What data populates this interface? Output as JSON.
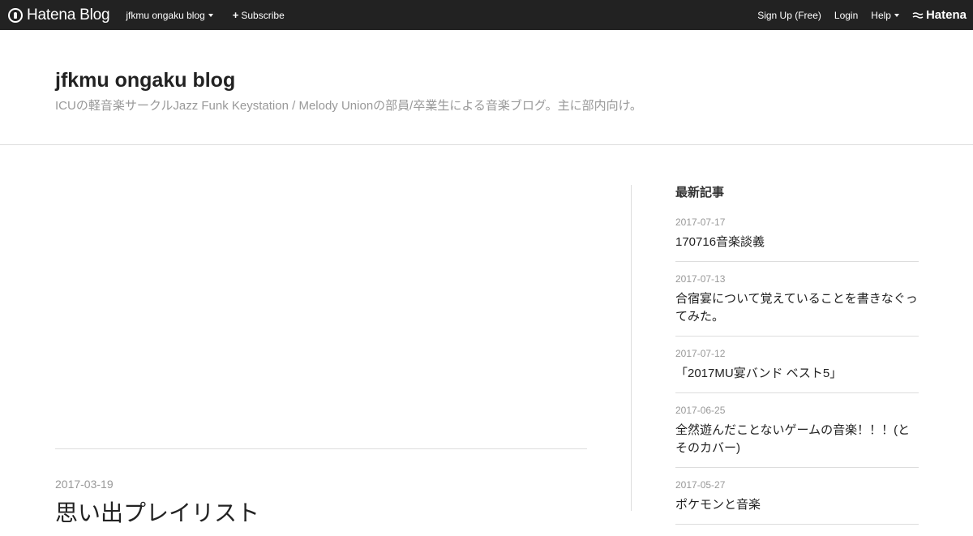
{
  "globalbar": {
    "logo_text": "Hatena Blog",
    "blog_menu_label": "jfkmu ongaku blog",
    "subscribe_label": "Subscribe",
    "signup_label": "Sign Up (Free)",
    "login_label": "Login",
    "help_label": "Help",
    "hatena_label": "Hatena"
  },
  "header": {
    "title": "jfkmu ongaku blog",
    "description": "ICUの軽音楽サークルJazz Funk Keystation / Melody Unionの部員/卒業生による音楽ブログ。主に部内向け。"
  },
  "entry": {
    "date": "2017-03-19",
    "title": "思い出プレイリスト"
  },
  "sidebar": {
    "heading": "最新記事",
    "items": [
      {
        "date": "2017-07-17",
        "title": "170716音楽談義"
      },
      {
        "date": "2017-07-13",
        "title": "合宿宴について覚えていることを書きなぐってみた。"
      },
      {
        "date": "2017-07-12",
        "title": "「2017MU宴バンド ベスト5」"
      },
      {
        "date": "2017-06-25",
        "title": "全然遊んだことないゲームの音楽！！！(とそのカバー)"
      },
      {
        "date": "2017-05-27",
        "title": "ポケモンと音楽"
      }
    ]
  },
  "colors": {
    "topbar": "#222222",
    "divider": "#dddddd",
    "muted_text": "#999999"
  }
}
